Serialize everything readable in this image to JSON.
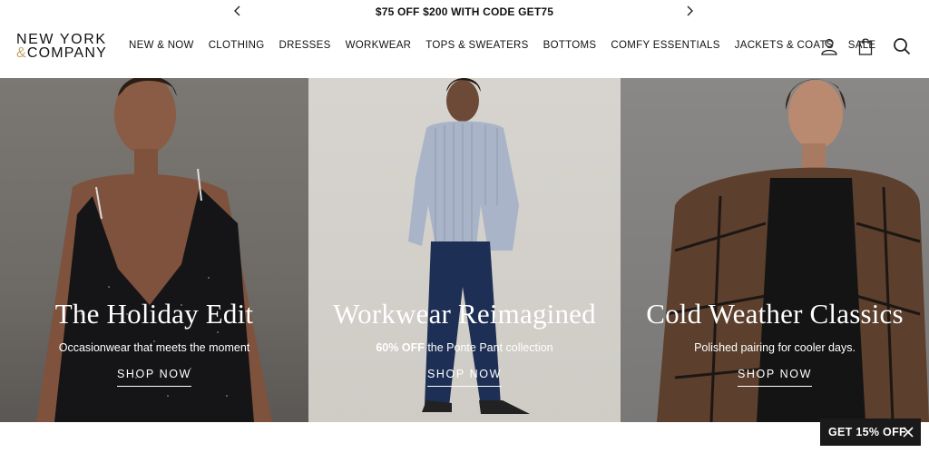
{
  "promo": {
    "text": "$75 OFF $200 WITH CODE GET75",
    "prev_icon": "chevron-left-icon",
    "next_icon": "chevron-right-icon"
  },
  "brand": {
    "line1": "NEW YORK",
    "amp": "&",
    "line2": "COMPANY",
    "accent_color": "#c7a46b"
  },
  "nav": {
    "items": [
      {
        "label": "NEW & NOW"
      },
      {
        "label": "CLOTHING"
      },
      {
        "label": "DRESSES"
      },
      {
        "label": "WORKWEAR"
      },
      {
        "label": "TOPS & SWEATERS"
      },
      {
        "label": "BOTTOMS"
      },
      {
        "label": "COMFY ESSENTIALS"
      },
      {
        "label": "JACKETS & COATS"
      },
      {
        "label": "SALE"
      }
    ]
  },
  "header_icons": [
    "account-icon",
    "shopping-bag-icon",
    "search-icon"
  ],
  "hero": {
    "tiles": [
      {
        "title": "The Holiday Edit",
        "subtitle": "Occasionwear that meets the moment",
        "cta": "SHOP NOW"
      },
      {
        "title": "Workwear Reimagined",
        "subtitle_bold": "60% OFF",
        "subtitle_rest": " the Ponte Pant collection",
        "cta": "SHOP NOW"
      },
      {
        "title": "Cold Weather Classics",
        "subtitle": "Polished pairing for cooler days.",
        "cta": "SHOP NOW"
      }
    ]
  },
  "discount_tab": {
    "label": "GET 15% OFF",
    "close_icon": "close-icon"
  }
}
